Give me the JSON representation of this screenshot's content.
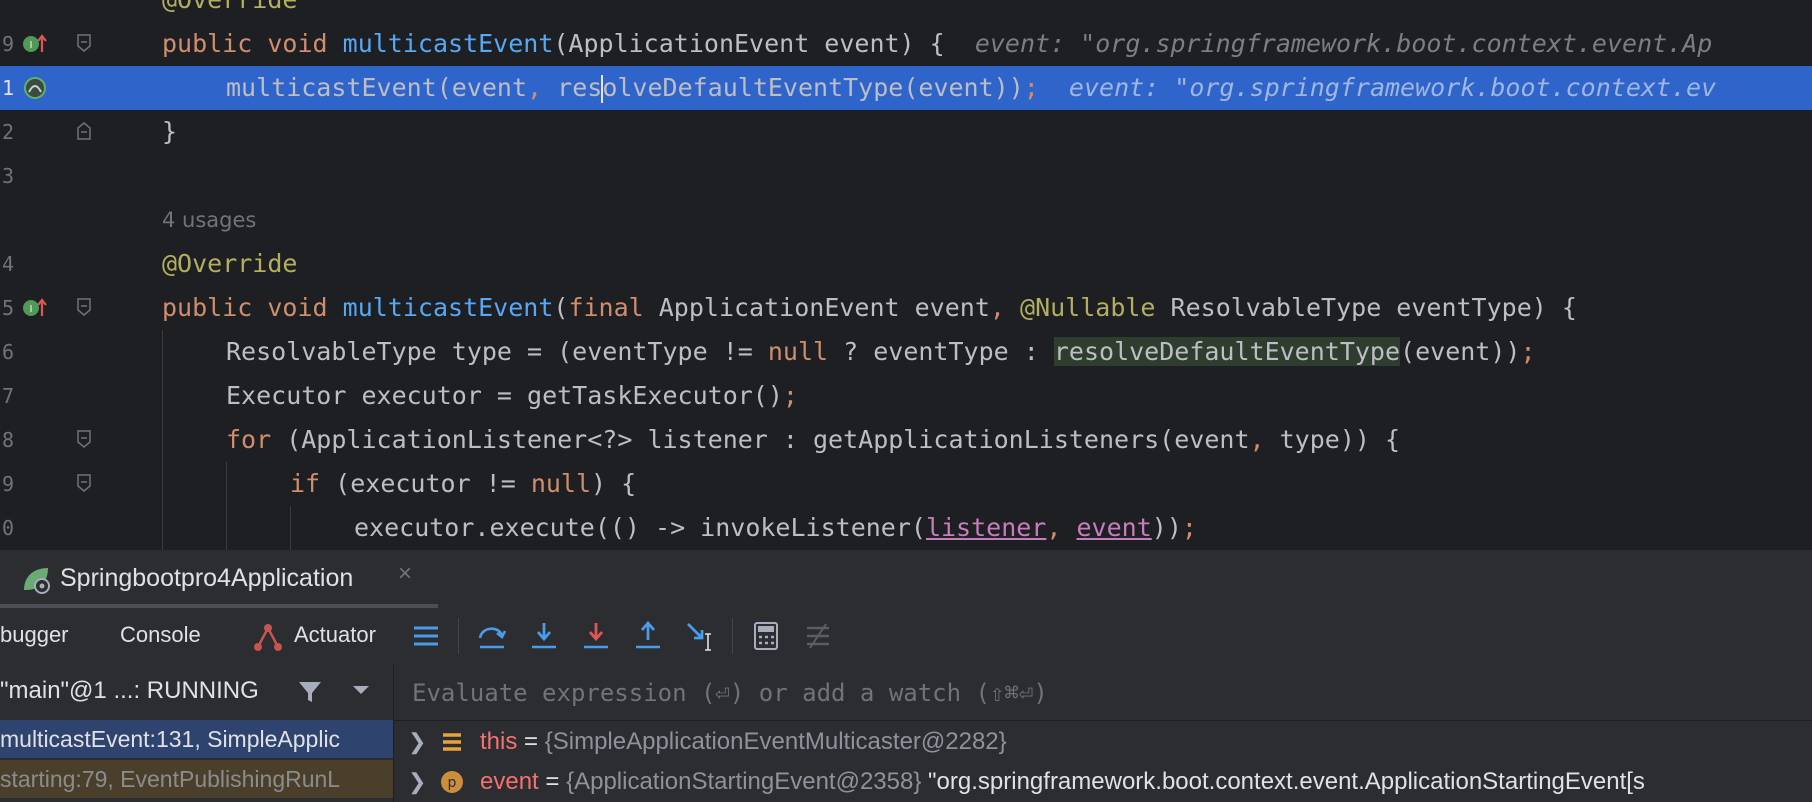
{
  "editor": {
    "line_numbers": [
      "9",
      "1",
      "2",
      "3",
      "",
      "4",
      "5",
      "6",
      "7",
      "8",
      "9",
      "0"
    ],
    "partial_top_annotation": "@Override",
    "line_129": {
      "kw1": "public",
      "kw2": "void",
      "fn": "multicastEvent",
      "rest": "(ApplicationEvent event) {",
      "hint": "event: \"org.springframework.boot.context.event.Ap"
    },
    "line_131": {
      "pre": "multicastEvent(event",
      "comma": ",",
      "mid_a": " res",
      "mid_b": "olveDefaultEventType(event))",
      "semi": ";",
      "hint": "event: \"org.springframework.boot.context.ev"
    },
    "line_132": "}",
    "usages": "4 usages",
    "override": "@Override",
    "line_135": {
      "kw1": "public",
      "kw2": "void",
      "fn": "multicastEvent",
      "paren": "(",
      "kw3": "final",
      "t1": " ApplicationEvent event",
      "comma": ",",
      "ann": "@Nullable",
      "t2": " ResolvableType eventType) {"
    },
    "line_136": {
      "a": "ResolvableType type = (eventType != ",
      "kw": "null",
      "b": " ? eventType : ",
      "hl": "resolveDefaultEventType",
      "c": "(event))",
      "semi": ";"
    },
    "line_137": {
      "a": "Executor executor = getTaskExecutor()",
      "semi": ";"
    },
    "line_138": {
      "kw": "for",
      "a": " (ApplicationListener<?> listener : getApplicationListeners(event",
      "comma": ",",
      "b": " type)) {"
    },
    "line_139": {
      "kw": "if",
      "a": " (executor != ",
      "kw2": "null",
      "b": ") {"
    },
    "line_140": {
      "a": "executor.execute(() -> invokeListener(",
      "u1": "listener",
      "comma": ",",
      "sp": " ",
      "u2": "event",
      "b": "))",
      "semi": ";"
    }
  },
  "run_tab": {
    "label": "Springbootpro4Application",
    "close": "×"
  },
  "toolbar": {
    "tab_debugger": "bugger",
    "tab_console": "Console",
    "tab_actuator": "Actuator"
  },
  "frames": {
    "thread_label": "\"main\"@1 ...: RUNNING",
    "rows": [
      "multicastEvent:131, SimpleApplic",
      "starting:79, EventPublishingRunL"
    ]
  },
  "variables": {
    "eval_placeholder": "Evaluate expression (⏎) or add a watch (⇧⌘⏎)",
    "items": [
      {
        "name": "this",
        "eq": " = ",
        "type": "{SimpleApplicationEventMulticaster@2282}",
        "value": ""
      },
      {
        "name": "event",
        "eq": " = ",
        "type": "{ApplicationStartingEvent@2358}",
        "value": " \"org.springframework.boot.context.event.ApplicationStartingEvent[s"
      }
    ]
  },
  "colors": {
    "selection": "#2f65ca",
    "editor_bg": "#1e1f22",
    "panel_bg": "#2b2d30",
    "keyword": "#cf8e6d",
    "function": "#56a8f5",
    "annotation": "#b3ae60"
  }
}
